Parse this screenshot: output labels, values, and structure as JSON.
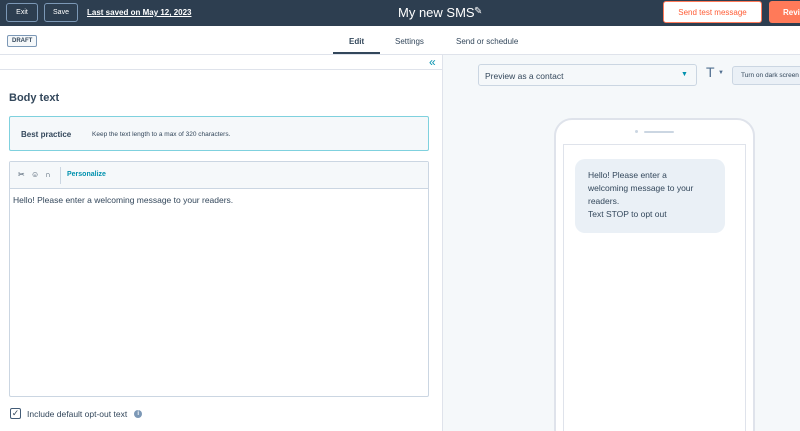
{
  "topbar": {
    "exit_label": "Exit",
    "save_label": "Save",
    "last_saved": "Last saved on May 12, 2023",
    "title": "My new SMS",
    "send_test_label": "Send test message",
    "review_label": "Revi"
  },
  "tabbar": {
    "status_badge": "DRAFT",
    "tabs": [
      {
        "label": "Edit",
        "active": true
      },
      {
        "label": "Settings",
        "active": false
      },
      {
        "label": "Send or schedule",
        "active": false
      }
    ]
  },
  "editor": {
    "section_title": "Body text",
    "best_practice_title": "Best practice",
    "best_practice_text": "Keep the text length to a max of 320 characters.",
    "personalize_label": "Personalize",
    "body_value": "Hello! Please enter a welcoming message to your readers.",
    "optout_label": "Include default opt-out text",
    "optout_checked": true
  },
  "preview": {
    "select_value": "Preview as a contact",
    "dark_screen_label": "Turn on dark screen",
    "message_lines": [
      "Hello! Please enter a",
      "welcoming message to your",
      "readers.",
      "Text STOP to opt out"
    ]
  },
  "icons": {
    "pencil": "pencil-icon",
    "collapse": "double-chevron-left-icon",
    "toolbar": [
      "cut-icon",
      "emoji-icon",
      "headset-icon"
    ],
    "font": "text-size-icon",
    "info": "info-icon",
    "checkbox": "check-icon"
  },
  "colors": {
    "topbar_bg": "#2d3e50",
    "accent_orange": "#ff7a59",
    "link_teal": "#0091ae",
    "text_dark": "#33475b",
    "panel_bg": "#f5f8fa"
  }
}
